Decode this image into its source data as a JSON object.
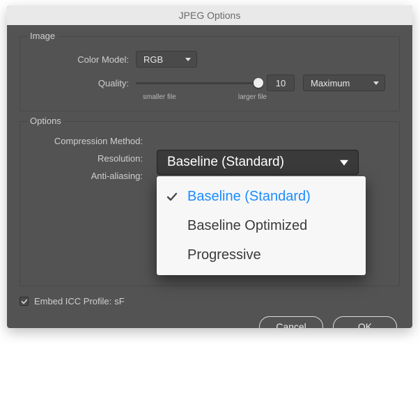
{
  "dialog": {
    "title": "JPEG Options"
  },
  "image_group": {
    "title": "Image",
    "color_model": {
      "label": "Color Model:",
      "value": "RGB"
    },
    "quality": {
      "label": "Quality:",
      "min_label": "smaller file",
      "max_label": "larger file",
      "value": "10",
      "preset": "Maximum"
    }
  },
  "options_group": {
    "title": "Options",
    "compression": {
      "label": "Compression Method:",
      "value": "Baseline (Standard)",
      "options": [
        "Baseline (Standard)",
        "Baseline Optimized",
        "Progressive"
      ],
      "selected_index": 0
    },
    "resolution": {
      "label": "Resolution:"
    },
    "anti_aliasing": {
      "label": "Anti-aliasing:"
    }
  },
  "embed_icc": {
    "label": "Embed ICC Profile:",
    "suffix": "sF",
    "checked": true
  },
  "buttons": {
    "cancel": "Cancel",
    "ok": "OK"
  }
}
